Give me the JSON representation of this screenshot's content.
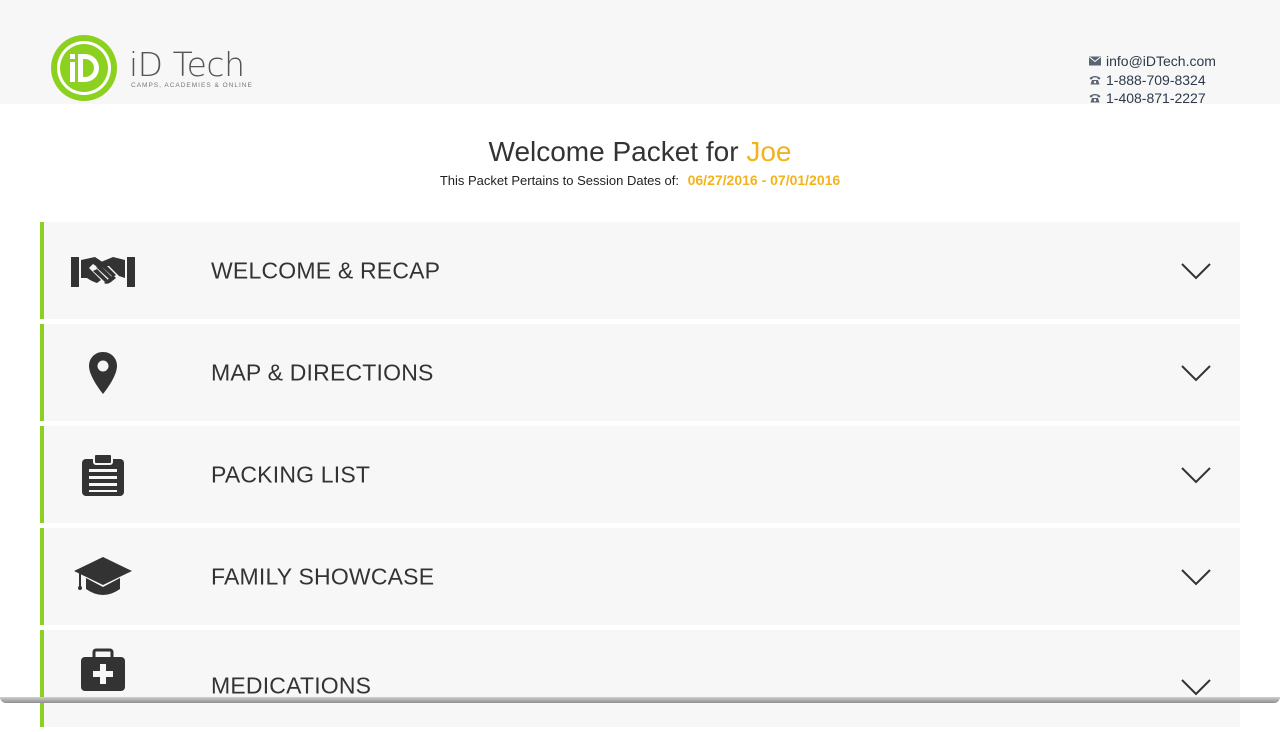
{
  "brand": {
    "name": "iD Tech",
    "tagline": "CAMPS, ACADEMIES & ONLINE",
    "accent_color": "#8cd11f",
    "highlight_color": "#f2b31b"
  },
  "contact": {
    "email": "info@iDTech.com",
    "phone_1": "1-888-709-8324",
    "phone_2": "1-408-871-2227"
  },
  "title": {
    "prefix": "Welcome Packet for",
    "name": "Joe",
    "subtitle_label": "This Packet Pertains to Session Dates of:",
    "session_dates": "06/27/2016 - 07/01/2016"
  },
  "sections": [
    {
      "label": "WELCOME & RECAP",
      "icon": "handshake-icon"
    },
    {
      "label": "MAP & DIRECTIONS",
      "icon": "map-pin-icon"
    },
    {
      "label": "PACKING LIST",
      "icon": "clipboard-icon"
    },
    {
      "label": "FAMILY SHOWCASE",
      "icon": "graduation-cap-icon"
    },
    {
      "label": "MEDICATIONS",
      "icon": "medical-kit-icon"
    }
  ]
}
